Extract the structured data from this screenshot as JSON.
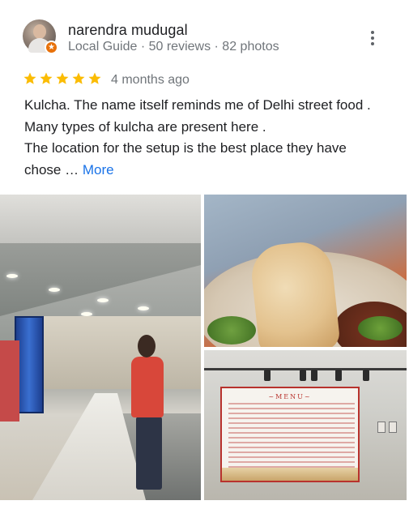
{
  "reviewer": {
    "name": "narendra mudugal",
    "meta": "Local Guide · 50 reviews · 82 photos"
  },
  "rating": {
    "stars": 5,
    "time": "4 months ago"
  },
  "review": {
    "lines": [
      "Kulcha. The name itself reminds me of Delhi street food .",
      "Many types of kulcha are present here .",
      "The location for the setup is the best place they have",
      "chose …"
    ],
    "more_label": "More"
  },
  "menu_photo": {
    "board_title": "~MENU~"
  },
  "colors": {
    "star": "#fbbc04",
    "link": "#1a73e8",
    "badge": "#e8710a"
  },
  "icons": {
    "more": "more-vert-icon",
    "star": "star-icon",
    "badge": "local-guide-badge-icon"
  }
}
